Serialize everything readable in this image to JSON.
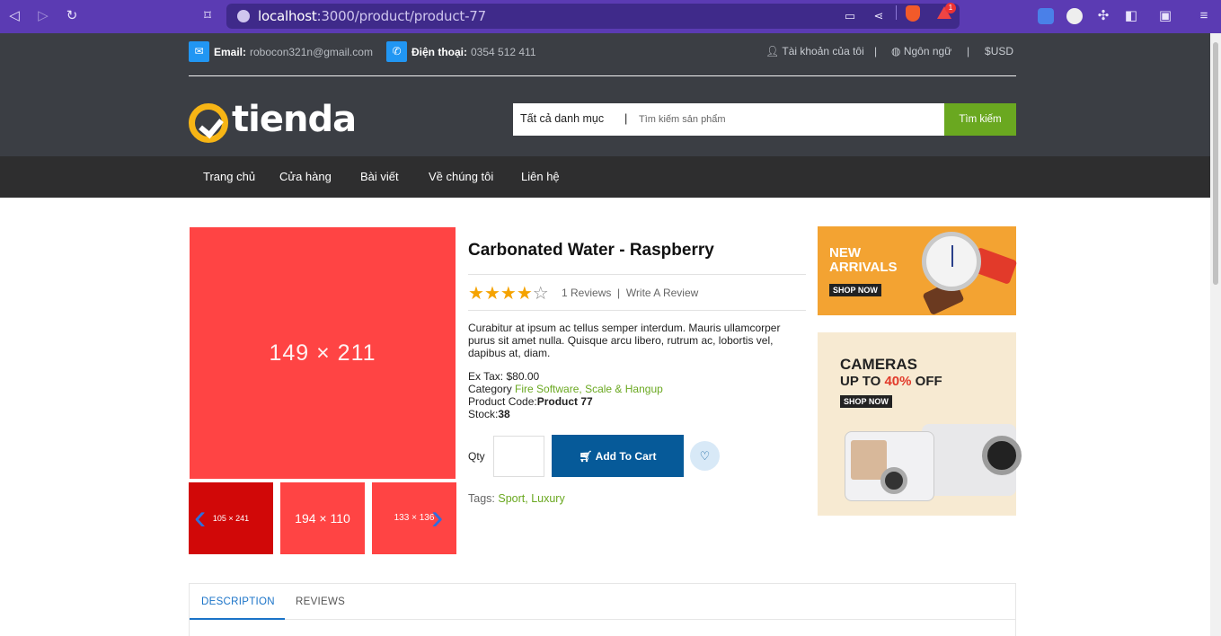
{
  "browser": {
    "url_host": "localhost",
    "url_path": ":3000/product/product-77",
    "bat_badge": "1"
  },
  "header": {
    "email_label": "Email:",
    "email_value": "robocon321n@gmail.com",
    "phone_label": "Điện thoại:",
    "phone_value": "0354 512 411",
    "account": "Tài khoản của tôi",
    "language": "Ngôn ngữ",
    "currency": "USD",
    "separator": "|",
    "logo_text": "tienda",
    "search_category": "Tất cả danh mục",
    "search_sep": "|",
    "search_placeholder": "Tìm kiếm sản phẩm",
    "search_button": "Tìm kiếm"
  },
  "menu": [
    "Trang chủ",
    "Cửa hàng",
    "Bài viết",
    "Về chúng tôi",
    "Liên hệ"
  ],
  "product": {
    "main_image_label": "149 × 211",
    "thumbs": [
      "105 × 241",
      "194 × 110",
      "133 × 136"
    ],
    "title": "Carbonated Water - Raspberry",
    "rating": 4,
    "rating_max": 5,
    "reviews_text": "1 Reviews",
    "review_sep": "|",
    "write_review": "Write A Review",
    "description": "Curabitur at ipsum ac tellus semper interdum. Mauris ullamcorper purus sit amet nulla. Quisque arcu libero, rutrum ac, lobortis vel, dapibus at, diam.",
    "ex_tax_label": "Ex Tax:",
    "ex_tax_value": "$80.00",
    "category_label": "Category",
    "category_value": "Fire Software, Scale & Hangup",
    "code_label": "Product Code:",
    "code_value": "Product 77",
    "stock_label": "Stock:",
    "stock_value": "38",
    "qty_label": "Qty",
    "qty_value": "",
    "add_to_cart": "Add To Cart",
    "tags_label": "Tags:",
    "tags": "Sport, Luxury"
  },
  "banners": {
    "b1_line1": "NEW",
    "b1_line2": "ARRIVALS",
    "b1_shop": "SHOP NOW",
    "b2_title": "CAMERAS",
    "b2_sub_a": "UP TO ",
    "b2_sub_red": "40%",
    "b2_sub_b": " OFF",
    "b2_shop": "SHOP NOW"
  },
  "tabs": [
    "DESCRIPTION",
    "REVIEWS"
  ],
  "colors": {
    "brand_green": "#6aa820",
    "cart_blue": "#065a99",
    "header_dark": "#3b3e44",
    "placeholder_red": "#ff4444"
  }
}
